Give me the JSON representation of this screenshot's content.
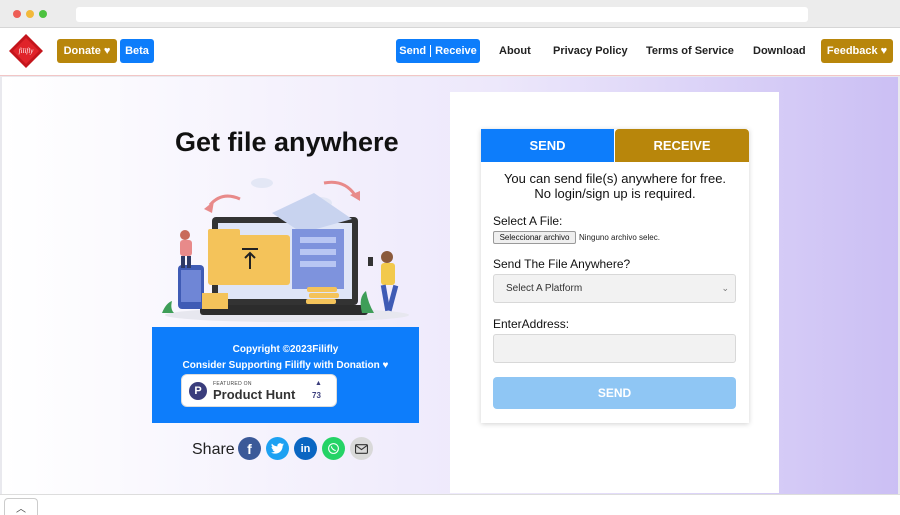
{
  "nav": {
    "donate_label": "Donate",
    "beta_label": "Beta",
    "send_label": "Send",
    "receive_label": "Receive",
    "about": "About",
    "privacy": "Privacy Policy",
    "terms": "Terms of Service",
    "download": "Download",
    "feedback_label": "Feedback",
    "heart_glyph": "♥"
  },
  "hero": {
    "headline": "Get file anywhere"
  },
  "footer_box": {
    "copyright": "Copyright ©2023Filifly",
    "support": "Consider Supporting Filifly with Donation ♥",
    "producthunt": {
      "featured": "FEATURED ON",
      "name": "Product Hunt",
      "count": "73",
      "logo_letter": "P"
    }
  },
  "share": {
    "label": "Share",
    "icons": [
      "facebook-icon",
      "twitter-icon",
      "linkedin-icon",
      "whatsapp-icon",
      "email-icon"
    ]
  },
  "form": {
    "tab_send": "SEND",
    "tab_receive": "RECEIVE",
    "info_line1": "You can send file(s) anywhere for free.",
    "info_line2": "No login/sign up is required.",
    "file_label": "Select A File:",
    "file_button": "Seleccionar archivo",
    "file_status": "Ninguno archivo selec.",
    "platform_label": "Send The File Anywhere?",
    "platform_selected": "Select A Platform",
    "address_label": "EnterAddress:",
    "address_value": "",
    "send_button": "SEND"
  },
  "colors": {
    "accent_blue": "#0d7dfb",
    "accent_gold": "#b8860b",
    "send_disabled": "#8fc6f4",
    "facebook": "#3b5998",
    "twitter": "#1da1f2",
    "linkedin": "#0a66c2",
    "whatsapp": "#25d366",
    "email": "#d9d9d9"
  }
}
